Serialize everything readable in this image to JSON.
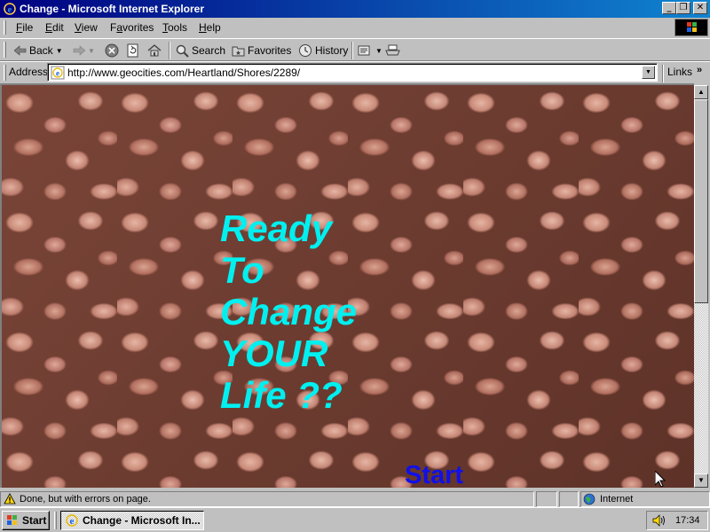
{
  "window": {
    "title": "Change - Microsoft Internet Explorer",
    "minimize_glyph": "_",
    "maximize_glyph": "❐",
    "close_glyph": "✕"
  },
  "menu": {
    "items": [
      {
        "label": "File",
        "accel": "F",
        "rest": "ile"
      },
      {
        "label": "Edit",
        "accel": "E",
        "rest": "dit"
      },
      {
        "label": "View",
        "accel": "V",
        "rest": "iew"
      },
      {
        "label": "Favorites",
        "accel": "a",
        "pre": "F",
        "rest": "vorites"
      },
      {
        "label": "Tools",
        "accel": "T",
        "rest": "ools"
      },
      {
        "label": "Help",
        "accel": "H",
        "rest": "elp"
      }
    ]
  },
  "toolbar": {
    "back_label": "Back",
    "search_label": "Search",
    "favorites_label": "Favorites",
    "history_label": "History"
  },
  "address": {
    "label": "Address",
    "url": "http://www.geocities.com/Heartland/Shores/2289/",
    "links_label": "Links",
    "links_arrow": "»"
  },
  "page": {
    "headline_lines": [
      "Ready",
      "To",
      "Change",
      "YOUR",
      "Life ??"
    ],
    "start_link": "Start",
    "text_color": "#00f0f0",
    "link_color": "#1010e8"
  },
  "status": {
    "message": "Done, but with errors on page.",
    "zone": "Internet"
  },
  "taskbar": {
    "start_label": "Start",
    "task_label": "Change - Microsoft In...",
    "clock": "17:34"
  }
}
